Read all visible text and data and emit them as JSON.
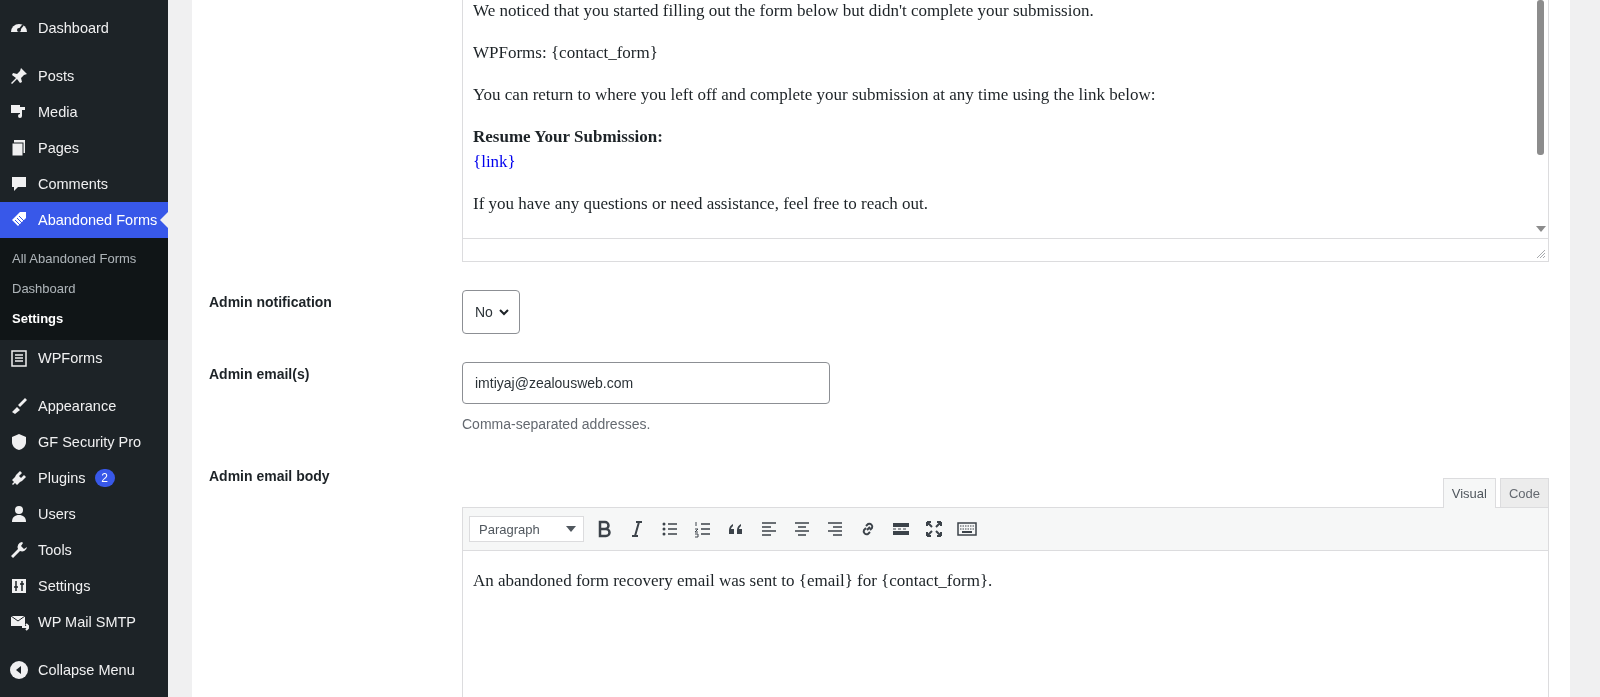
{
  "sidebar": {
    "groups": [
      [
        {
          "label": "Dashboard",
          "selected": false
        }
      ],
      [
        {
          "label": "Posts",
          "selected": false
        },
        {
          "label": "Media",
          "selected": false
        },
        {
          "label": "Pages",
          "selected": false
        },
        {
          "label": "Comments",
          "selected": false
        },
        {
          "label": "Abandoned Forms",
          "selected": true,
          "children": [
            {
              "label": "All Abandoned Forms",
              "selected": false
            },
            {
              "label": "Dashboard",
              "selected": false
            },
            {
              "label": "Settings",
              "selected": true
            }
          ]
        },
        {
          "label": "WPForms",
          "selected": false
        }
      ],
      [
        {
          "label": "Appearance",
          "selected": false
        },
        {
          "label": "GF Security Pro",
          "selected": false
        },
        {
          "label": "Plugins",
          "selected": false,
          "badge": "2"
        },
        {
          "label": "Users",
          "selected": false
        },
        {
          "label": "Tools",
          "selected": false
        },
        {
          "label": "Settings",
          "selected": false
        },
        {
          "label": "WP Mail SMTP",
          "selected": false
        }
      ]
    ],
    "collapse_label": "Collapse Menu"
  },
  "user_email_body": {
    "paragraphs": [
      {
        "text": "We noticed that you started filling out the form below but didn't complete your submission."
      },
      {
        "text": "WPForms: {contact_form}"
      },
      {
        "text": "You can return to where you left off and complete your submission at any time using the link below:"
      },
      {
        "text": "Resume Your Submission:",
        "link": "{link}"
      },
      {
        "text": "If you have any questions or need assistance, feel free to reach out."
      }
    ]
  },
  "fields": [
    {
      "kind": "select",
      "label": "Admin notification",
      "value": "No"
    },
    {
      "kind": "input",
      "label": "Admin email(s)",
      "value": "imtiyaj@zealousweb.com",
      "hint": "Comma-separated addresses."
    },
    {
      "kind": "editor",
      "label": "Admin email body",
      "tabs": [
        {
          "label": "Visual",
          "selected": true
        },
        {
          "label": "Code",
          "selected": false
        }
      ],
      "format": "Paragraph",
      "content": "An abandoned form recovery email was sent to {email} for {contact_form}."
    }
  ]
}
